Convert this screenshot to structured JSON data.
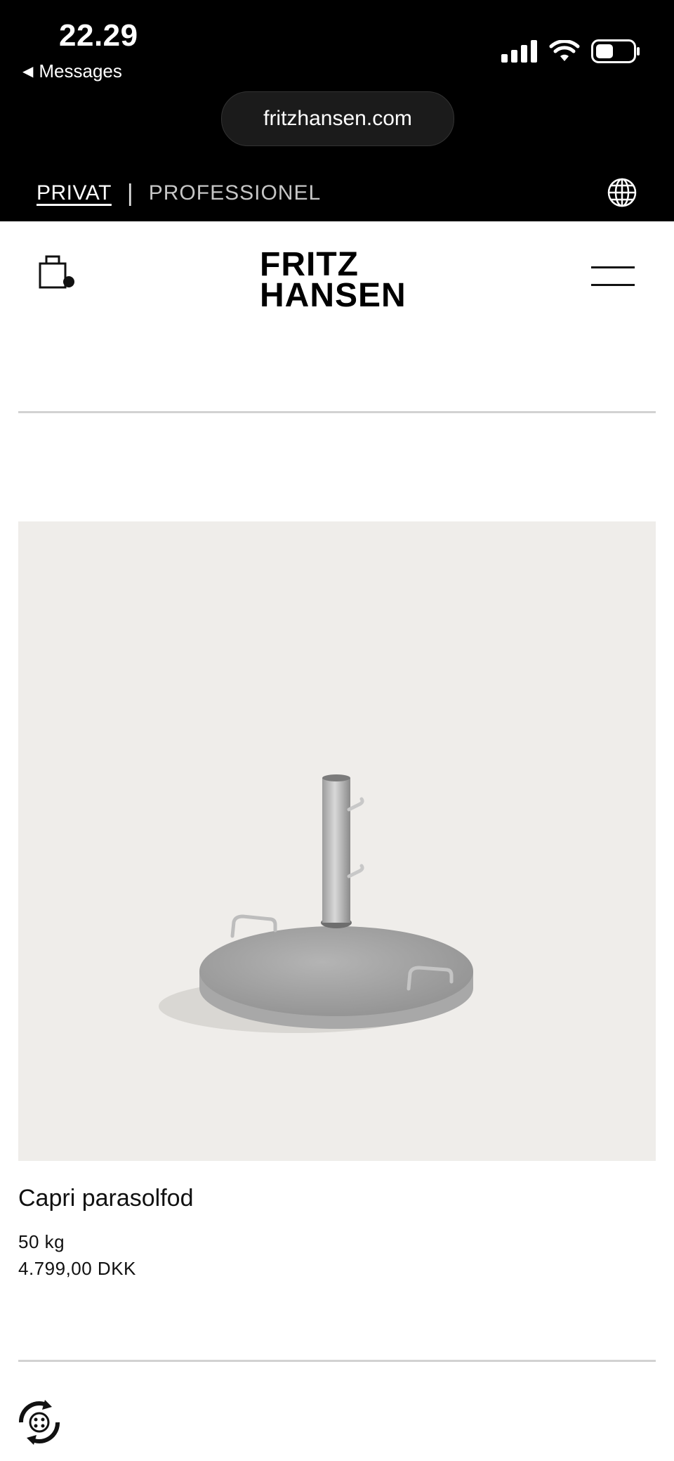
{
  "status_bar": {
    "time": "22.29",
    "back_label": "Messages",
    "url": "fritzhansen.com"
  },
  "top_nav": {
    "privat_label": "PRIVAT",
    "separator": "|",
    "professionel_label": "PROFESSIONEL",
    "icons": [
      "globe-icon"
    ]
  },
  "header": {
    "logo_line1": "FRITZ",
    "logo_line2": "HANSEN",
    "icons": [
      "shopping-bag-icon",
      "hamburger-menu-icon"
    ]
  },
  "product": {
    "title": "Capri parasolfod",
    "weight": "50 kg",
    "price": "4.799,00 DKK",
    "image_icon": "parasol-base-image"
  },
  "footer": {
    "icons": [
      "recycle-badge-icon"
    ]
  },
  "colors": {
    "top_bar_bg": "#000000",
    "page_bg": "#ffffff",
    "product_bg": "#efedea",
    "divider": "#d2d2d2"
  }
}
